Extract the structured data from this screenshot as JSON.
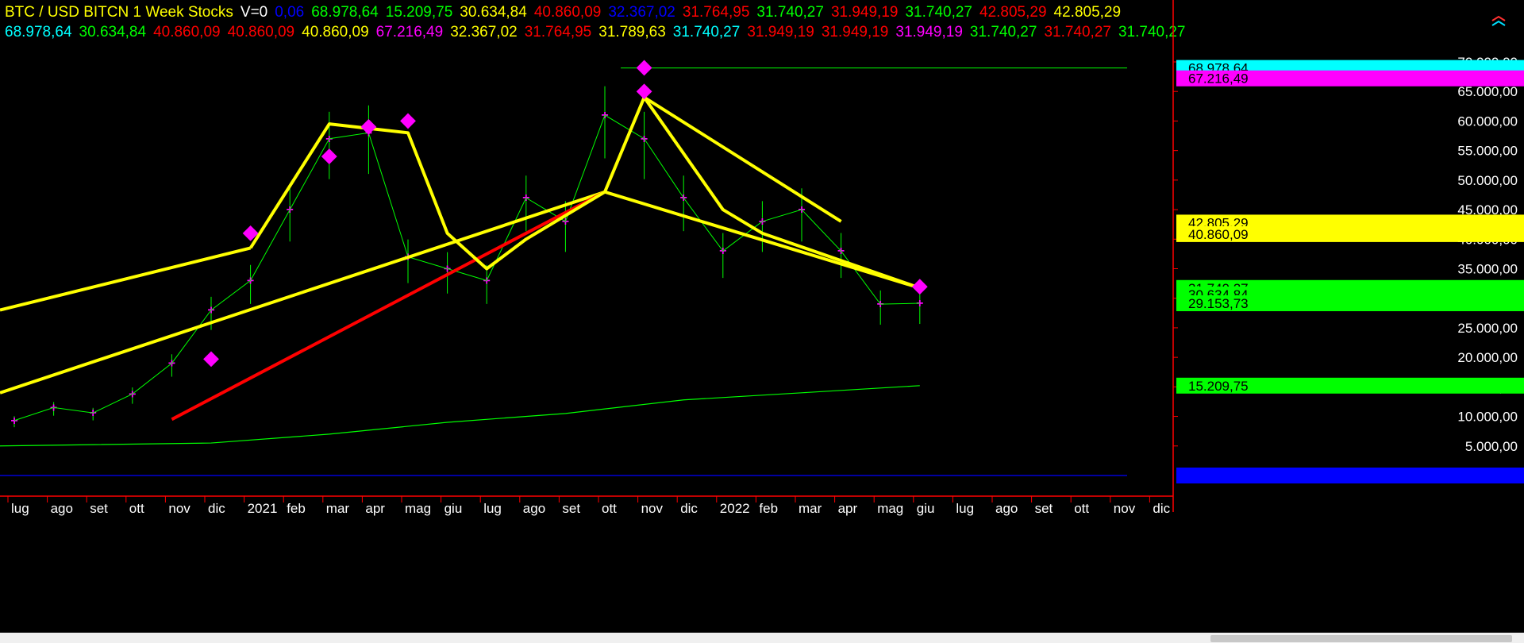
{
  "header": {
    "row1": [
      {
        "text": "BTC / USD BITCN  1 Week  Stocks",
        "color": "#ffff00"
      },
      {
        "text": "V=0",
        "color": "#ffffff"
      },
      {
        "text": "0,06",
        "color": "#0000ff"
      },
      {
        "text": "68.978,64",
        "color": "#00ff00"
      },
      {
        "text": "15.209,75",
        "color": "#00ff00"
      },
      {
        "text": "30.634,84",
        "color": "#ffff00"
      },
      {
        "text": "40.860,09",
        "color": "#ff0000"
      },
      {
        "text": "32.367,02",
        "color": "#0000ff"
      },
      {
        "text": "31.764,95",
        "color": "#ff0000"
      },
      {
        "text": "31.740,27",
        "color": "#00ff00"
      },
      {
        "text": "31.949,19",
        "color": "#ff0000"
      },
      {
        "text": "31.740,27",
        "color": "#00ff00"
      },
      {
        "text": "42.805,29",
        "color": "#ff0000"
      },
      {
        "text": "42.805,29",
        "color": "#ffff00"
      }
    ],
    "row2": [
      {
        "text": "68.978,64",
        "color": "#00ffff"
      },
      {
        "text": "30.634,84",
        "color": "#00ff00"
      },
      {
        "text": "40.860,09",
        "color": "#ff0000"
      },
      {
        "text": "40.860,09",
        "color": "#ff0000"
      },
      {
        "text": "40.860,09",
        "color": "#ffff00"
      },
      {
        "text": "67.216,49",
        "color": "#ff00ff"
      },
      {
        "text": "32.367,02",
        "color": "#ffff00"
      },
      {
        "text": "31.764,95",
        "color": "#ff0000"
      },
      {
        "text": "31.789,63",
        "color": "#ffff00"
      },
      {
        "text": "31.740,27",
        "color": "#00ffff"
      },
      {
        "text": "31.949,19",
        "color": "#ff0000"
      },
      {
        "text": "31.949,19",
        "color": "#ff0000"
      },
      {
        "text": "31.949,19",
        "color": "#ff00ff"
      },
      {
        "text": "31.740,27",
        "color": "#00ff00"
      },
      {
        "text": "31.740,27",
        "color": "#ff0000"
      },
      {
        "text": "31.740,27",
        "color": "#00ff00"
      }
    ]
  },
  "axis": {
    "y_ticks": [
      "70.000,00",
      "65.000,00",
      "60.000,00",
      "55.000,00",
      "50.000,00",
      "45.000,00",
      "40.000,00",
      "35.000,00",
      "30.000,00",
      "25.000,00",
      "20.000,00",
      "15.000,00",
      "10.000,00",
      "5.000,00"
    ],
    "x_ticks": [
      "lug",
      "ago",
      "set",
      "ott",
      "nov",
      "dic",
      "2021",
      "feb",
      "mar",
      "apr",
      "mag",
      "giu",
      "lug",
      "ago",
      "set",
      "ott",
      "nov",
      "dic",
      "2022",
      "feb",
      "mar",
      "apr",
      "mag",
      "giu",
      "lug",
      "ago",
      "set",
      "ott",
      "nov",
      "dic"
    ],
    "price_tags": [
      {
        "text": "68.978,64",
        "bg": "#00ffff",
        "fg": "#000000",
        "value": 68978.64
      },
      {
        "text": "67.216,49",
        "bg": "#ff00ff",
        "fg": "#000000",
        "value": 67216.49
      },
      {
        "text": "42.805,29",
        "bg": "#ffff00",
        "fg": "#000000",
        "value": 42805.29
      },
      {
        "text": "40.860,09",
        "bg": "#ffff00",
        "fg": "#000000",
        "value": 40860.09
      },
      {
        "text": "31.740,27",
        "bg": "#00ff00",
        "fg": "#000000",
        "value": 31740.27
      },
      {
        "text": "30.634,84",
        "bg": "#00ff00",
        "fg": "#000000",
        "value": 30634.84
      },
      {
        "text": "29.153,73",
        "bg": "#00ff00",
        "fg": "#000000",
        "value": 29153.73
      },
      {
        "text": "15.209,75",
        "bg": "#00ff00",
        "fg": "#000000",
        "value": 15209.75
      },
      {
        "text": "0,06",
        "bg": "#0000ff",
        "fg": "#0000ff",
        "value": 0.06
      }
    ]
  },
  "colors": {
    "background": "#000000",
    "axis_line": "#ff0000",
    "price_line": "#00ff00",
    "trend": "#ffff00",
    "signal_red": "#ff0000",
    "marker": "#ff00ff",
    "cyan": "#00ffff",
    "zero_line": "#0000ff"
  },
  "chart_data": {
    "type": "line",
    "title": "BTC / USD BITCN  1 Week  Stocks",
    "xlabel": "",
    "ylabel": "",
    "ylim": [
      0,
      70000
    ],
    "x": [
      "2020-07",
      "2020-08",
      "2020-09",
      "2020-10",
      "2020-11",
      "2020-12",
      "2021-01",
      "2021-02",
      "2021-03",
      "2021-04",
      "2021-05",
      "2021-06",
      "2021-07",
      "2021-08",
      "2021-09",
      "2021-10",
      "2021-11",
      "2021-12",
      "2022-01",
      "2022-02",
      "2022-03",
      "2022-04",
      "2022-05",
      "2022-06"
    ],
    "series": [
      {
        "name": "",
        "values": [
          9300,
          11500,
          10600,
          13800,
          19000,
          28000,
          33000,
          45000,
          57000,
          58000,
          37000,
          35000,
          33000,
          47000,
          43000,
          61000,
          57000,
          47000,
          38000,
          43000,
          45000,
          38000,
          29000,
          29153.73
        ]
      }
    ],
    "trend_lines": [
      {
        "color": "yellow",
        "points": [
          [
            "2020-06",
            28000
          ],
          [
            "2021-01",
            38500
          ]
        ]
      },
      {
        "color": "yellow",
        "points": [
          [
            "2020-06",
            14000
          ],
          [
            "2021-10",
            48000
          ],
          [
            "2022-06",
            31740
          ]
        ]
      },
      {
        "color": "red",
        "points": [
          [
            "2020-11",
            9500
          ],
          [
            "2021-10",
            48000
          ]
        ]
      },
      {
        "color": "yellow",
        "points": [
          [
            "2021-01",
            38500
          ],
          [
            "2021-03",
            59500
          ],
          [
            "2021-05",
            58000
          ],
          [
            "2021-06",
            41000
          ],
          [
            "2021-07",
            35000
          ],
          [
            "2021-08",
            40000
          ],
          [
            "2021-10",
            48000
          ],
          [
            "2021-11",
            64000
          ],
          [
            "2022-01",
            45000
          ],
          [
            "2022-02",
            41000
          ],
          [
            "2022-06",
            31740
          ]
        ]
      },
      {
        "color": "yellow",
        "points": [
          [
            "2021-11",
            64000
          ],
          [
            "2022-04",
            43000
          ]
        ]
      }
    ],
    "levels": [
      {
        "name": "",
        "value": 68978.64
      },
      {
        "name": "",
        "value": 15209.75
      },
      {
        "name": "",
        "value": 0.06
      }
    ]
  }
}
